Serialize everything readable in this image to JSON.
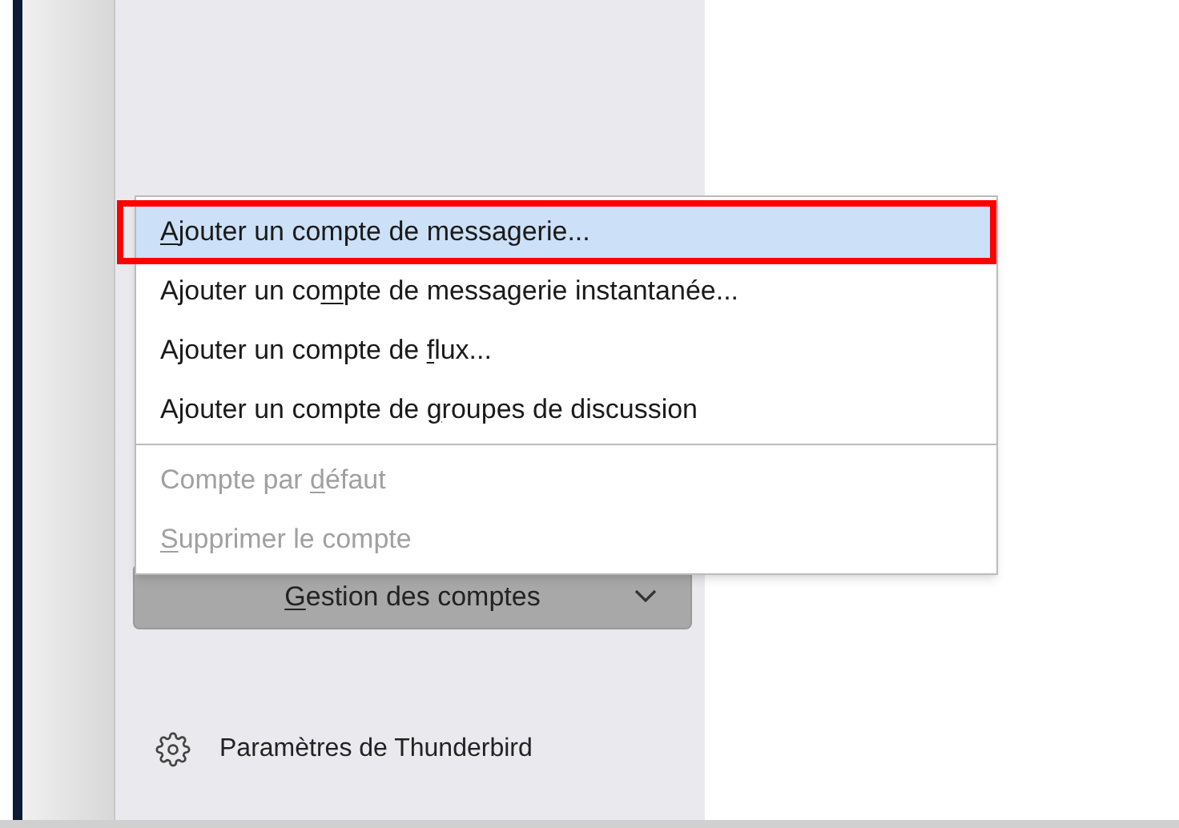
{
  "menu": {
    "items": [
      {
        "kind": "item",
        "access_key": "A",
        "text_after": "jouter un compte de messagerie...",
        "selected": true,
        "disabled": false,
        "annotated": true
      },
      {
        "kind": "item",
        "text_before": "Ajouter un co",
        "access_key": "m",
        "text_after": "pte de messagerie instantanée...",
        "selected": false,
        "disabled": false,
        "annotated": false
      },
      {
        "kind": "item",
        "text_before": "Ajouter un compte de ",
        "access_key": "f",
        "text_after": "lux...",
        "selected": false,
        "disabled": false,
        "annotated": false
      },
      {
        "kind": "item",
        "text_before": "Ajouter un compte de ",
        "access_key": "g",
        "text_after": "roupes de discussion",
        "selected": false,
        "disabled": false,
        "annotated": false
      },
      {
        "kind": "separator"
      },
      {
        "kind": "item",
        "text_before": "Compte par ",
        "access_key": "d",
        "text_after": "éfaut",
        "selected": false,
        "disabled": true,
        "annotated": false
      },
      {
        "kind": "item",
        "access_key": "S",
        "text_after": "upprimer le compte",
        "selected": false,
        "disabled": true,
        "annotated": false
      }
    ]
  },
  "account_button": {
    "access_key": "G",
    "text_after": "estion des comptes",
    "expanded": true
  },
  "settings_link": {
    "label": "Paramètres de Thunderbird"
  }
}
